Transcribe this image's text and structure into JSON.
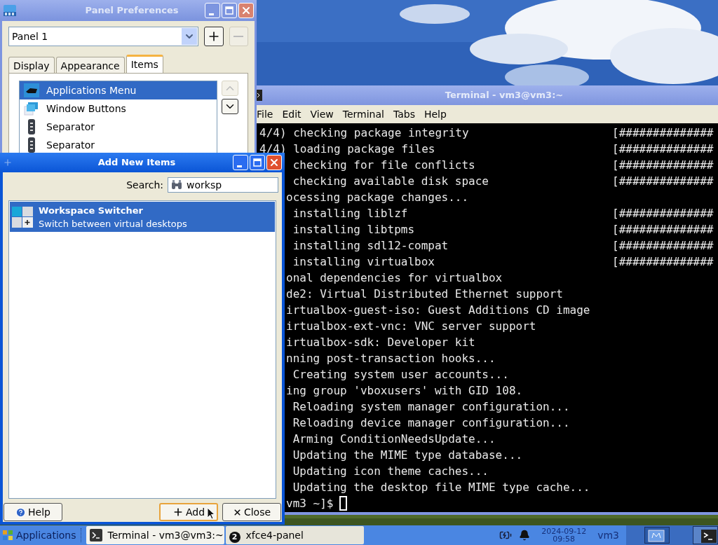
{
  "panel_preferences": {
    "title": "Panel Preferences",
    "panel_select": {
      "value": "Panel 1"
    },
    "panel_buttons": [
      {
        "kind": "add",
        "disabled": false
      },
      {
        "kind": "remove",
        "disabled": true
      }
    ],
    "tabs": [
      {
        "label": "Display",
        "selected": false
      },
      {
        "label": "Appearance",
        "selected": false
      },
      {
        "label": "Items",
        "selected": true
      }
    ],
    "items": [
      {
        "label": "Applications Menu",
        "kind": "menu",
        "selected": true
      },
      {
        "label": "Window Buttons",
        "kind": "windows",
        "selected": false
      },
      {
        "label": "Separator",
        "kind": "separator",
        "selected": false
      },
      {
        "label": "Separator",
        "kind": "separator",
        "selected": false
      }
    ],
    "move_buttons": [
      {
        "kind": "up",
        "disabled": true
      },
      {
        "kind": "down",
        "disabled": false
      }
    ]
  },
  "terminal": {
    "title": "Terminal - vm3@vm3:~",
    "menu": [
      "File",
      "Edit",
      "View",
      "Terminal",
      "Tabs",
      "Help"
    ],
    "lines": [
      {
        "kind": "full",
        "text": "4/4) checking package integrity",
        "progress": "[##############"
      },
      {
        "kind": "full",
        "text": "4/4) loading package files",
        "progress": "[##############"
      },
      {
        "kind": "cut",
        "text": " checking for file conflicts",
        "progress": "[##############"
      },
      {
        "kind": "cut",
        "text": " checking available disk space",
        "progress": "[##############"
      },
      {
        "kind": "cut",
        "text": "ocessing package changes..."
      },
      {
        "kind": "cut",
        "text": " installing liblzf",
        "progress": "[##############"
      },
      {
        "kind": "cut",
        "text": " installing libtpms",
        "progress": "[##############"
      },
      {
        "kind": "cut",
        "text": " installing sdl12-compat",
        "progress": "[##############"
      },
      {
        "kind": "cut",
        "text": " installing virtualbox",
        "progress": "[##############"
      },
      {
        "kind": "cut",
        "text": "onal dependencies for virtualbox"
      },
      {
        "kind": "cut",
        "text": "de2: Virtual Distributed Ethernet support"
      },
      {
        "kind": "cut",
        "text": "irtualbox-guest-iso: Guest Additions CD image"
      },
      {
        "kind": "cut",
        "text": "irtualbox-ext-vnc: VNC server support"
      },
      {
        "kind": "cut",
        "text": "irtualbox-sdk: Developer kit"
      },
      {
        "kind": "cut",
        "text": "nning post-transaction hooks..."
      },
      {
        "kind": "cut",
        "text": " Creating system user accounts..."
      },
      {
        "kind": "cut",
        "text": "ing group 'vboxusers' with GID 108."
      },
      {
        "kind": "cut",
        "text": " Reloading system manager configuration..."
      },
      {
        "kind": "cut",
        "text": " Reloading device manager configuration..."
      },
      {
        "kind": "cut",
        "text": " Arming ConditionNeedsUpdate..."
      },
      {
        "kind": "cut",
        "text": " Updating the MIME type database..."
      },
      {
        "kind": "cut",
        "text": " Updating icon theme caches..."
      },
      {
        "kind": "cut",
        "text": " Updating the desktop file MIME type cache..."
      }
    ],
    "prompt": "vm3 ~]$"
  },
  "add_items": {
    "title": "Add New Items",
    "search": {
      "label": "Search:",
      "value": "worksp"
    },
    "results": [
      {
        "name": "Workspace Switcher",
        "description": "Switch between virtual desktops",
        "selected": true
      }
    ],
    "buttons": [
      {
        "kind": "help",
        "label": "Help",
        "focused": false
      },
      {
        "kind": "add",
        "label": "Add",
        "focused": true
      },
      {
        "kind": "close",
        "label": "Close",
        "focused": false
      }
    ]
  },
  "taskbar": {
    "menu": "Applications",
    "tasks": [
      {
        "kind": "terminal",
        "label": "Terminal - vm3@vm3:~"
      },
      {
        "kind": "panel",
        "label": "xfce4-panel",
        "badge": "2"
      }
    ],
    "clock": {
      "date": "2024-09-12",
      "time": "09:58"
    },
    "user": "vm3"
  }
}
